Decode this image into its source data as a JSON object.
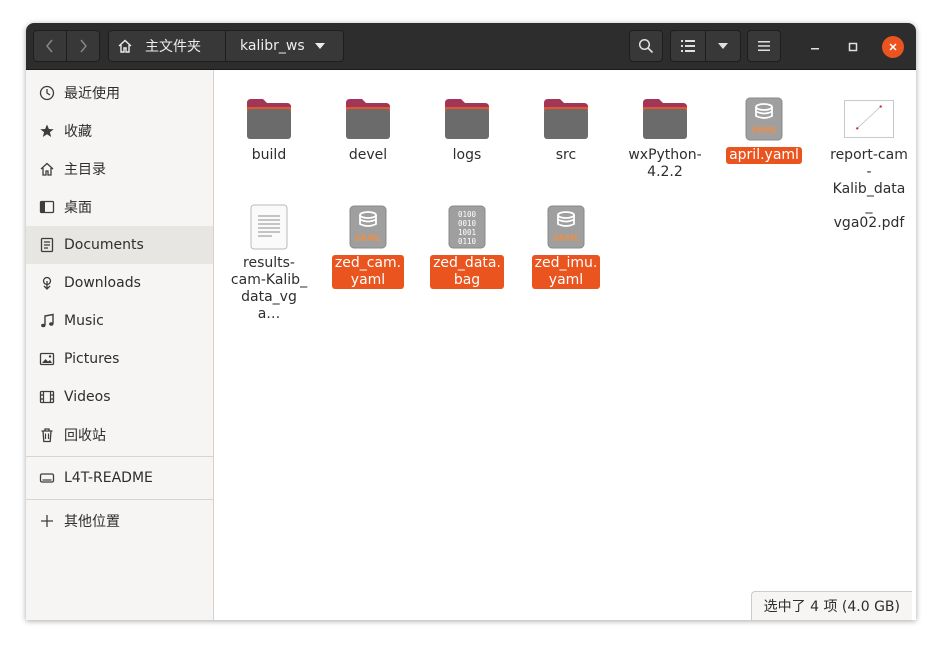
{
  "header": {
    "path": {
      "home_label": "主文件夹",
      "current_label": "kalibr_ws"
    }
  },
  "sidebar": {
    "items": [
      {
        "label": "最近使用",
        "icon": "clock-icon"
      },
      {
        "label": "收藏",
        "icon": "star-icon"
      },
      {
        "label": "主目录",
        "icon": "home-icon"
      },
      {
        "label": "桌面",
        "icon": "desktop-icon"
      },
      {
        "label": "Documents",
        "icon": "document-icon",
        "active": true
      },
      {
        "label": "Downloads",
        "icon": "download-icon"
      },
      {
        "label": "Music",
        "icon": "music-icon"
      },
      {
        "label": "Pictures",
        "icon": "picture-icon"
      },
      {
        "label": "Videos",
        "icon": "film-icon"
      },
      {
        "label": "回收站",
        "icon": "trash-icon"
      }
    ],
    "devices": [
      {
        "label": "L4T-README",
        "icon": "drive-icon"
      }
    ],
    "other": {
      "label": "其他位置",
      "icon": "plus-icon"
    }
  },
  "files": [
    {
      "name": "build",
      "type": "folder",
      "selected": false
    },
    {
      "name": "devel",
      "type": "folder",
      "selected": false
    },
    {
      "name": "logs",
      "type": "folder",
      "selected": false
    },
    {
      "name": "src",
      "type": "folder",
      "selected": false
    },
    {
      "name": "wxPython-\n4.2.2",
      "type": "folder",
      "selected": false
    },
    {
      "name": "april.yaml",
      "type": "yaml",
      "selected": true
    },
    {
      "name": "report-cam-\nKalib_data_\nvga02.pdf",
      "type": "pdf",
      "selected": false
    },
    {
      "name": "results-\ncam-Kalib_\ndata_vga…",
      "type": "text",
      "selected": false
    },
    {
      "name": "zed_cam.\nyaml",
      "type": "yaml",
      "selected": true
    },
    {
      "name": "zed_data.\nbag",
      "type": "binary",
      "selected": true
    },
    {
      "name": "zed_imu.\nyaml",
      "type": "yaml",
      "selected": true
    }
  ],
  "status": {
    "text": "选中了 4 项 (4.0 GB)"
  },
  "colors": {
    "accent": "#e9541f",
    "folder_tab": "#a23657",
    "headerbar": "#2d2d2d"
  }
}
